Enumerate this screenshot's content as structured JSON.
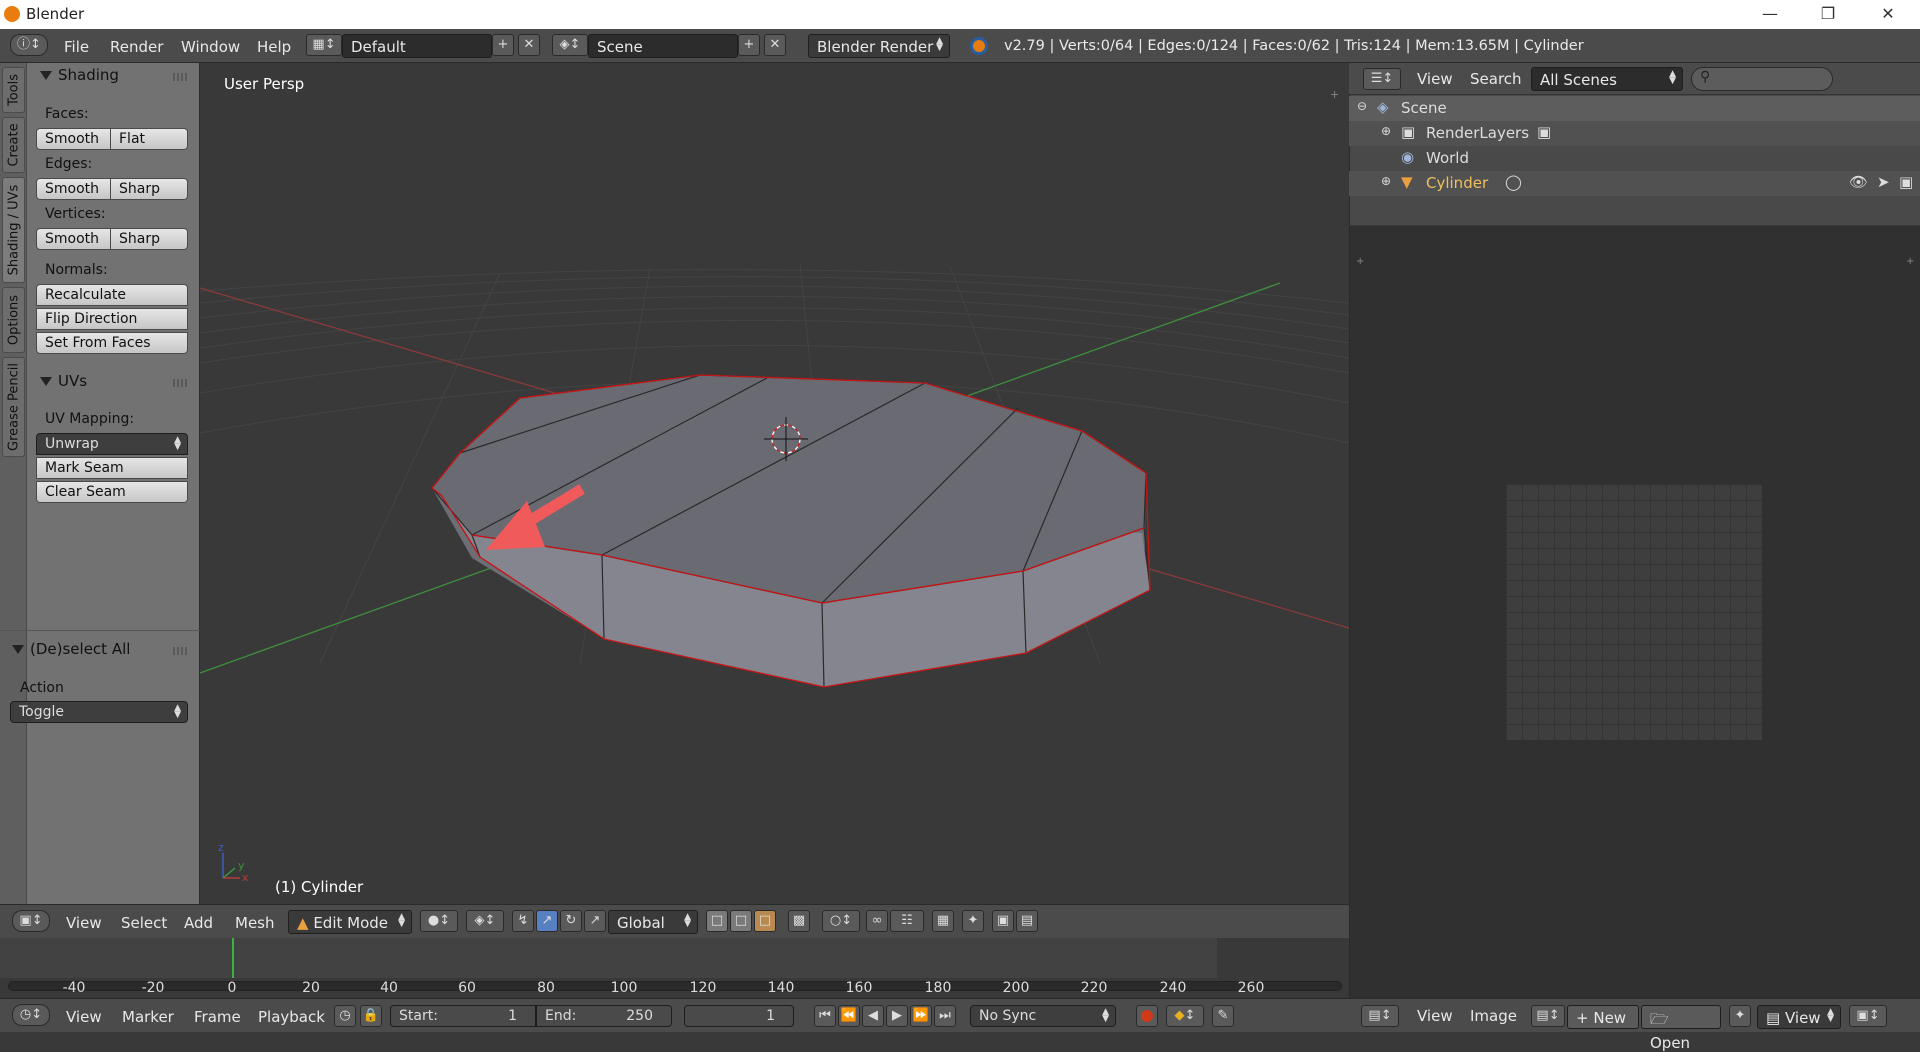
{
  "window": {
    "title": "Blender",
    "controls": [
      "minimize-icon",
      "maximize-icon",
      "close-icon"
    ]
  },
  "infobar": {
    "menus": [
      "File",
      "Render",
      "Window",
      "Help"
    ],
    "screen_layout": "Default",
    "scene": "Scene",
    "render_engine": "Blender Render",
    "stats": "v2.79 | Verts:0/64 | Edges:0/124 | Faces:0/62 | Tris:124 | Mem:13.65M | Cylinder"
  },
  "toolshelf": {
    "tabs": [
      "Tools",
      "Create",
      "Shading / UVs",
      "Options",
      "Grease Pencil"
    ],
    "active_tab": "Shading / UVs",
    "shading_panel": {
      "title": "Shading",
      "faces_label": "Faces:",
      "faces_smooth": "Smooth",
      "faces_flat": "Flat",
      "edges_label": "Edges:",
      "edges_smooth": "Smooth",
      "edges_sharp": "Sharp",
      "vertices_label": "Vertices:",
      "vertices_smooth": "Smooth",
      "vertices_sharp": "Sharp",
      "normals_label": "Normals:",
      "recalculate": "Recalculate",
      "flip_direction": "Flip Direction",
      "set_from_faces": "Set From Faces"
    },
    "uvs_panel": {
      "title": "UVs",
      "uv_mapping_label": "UV Mapping:",
      "unwrap": "Unwrap",
      "mark_seam": "Mark Seam",
      "clear_seam": "Clear Seam"
    },
    "operator_panel": {
      "title": "(De)select All",
      "action_label": "Action",
      "action_value": "Toggle"
    }
  },
  "viewport": {
    "view_label": "User Persp",
    "object_label": "(1) Cylinder",
    "axis_labels": [
      "z",
      "y",
      "x"
    ],
    "colors": {
      "background": "#393939",
      "edge_selected": "#c81414",
      "x_axis": "#a03a3a",
      "y_axis": "#3f8f3f",
      "arrow": "#f05a5a"
    }
  },
  "viewport_header": {
    "menus": [
      "View",
      "Select",
      "Add",
      "Mesh"
    ],
    "mode": "Edit Mode",
    "orientation": "Global"
  },
  "timeline": {
    "ticks": [
      "-40",
      "-20",
      "0",
      "20",
      "40",
      "60",
      "80",
      "100",
      "120",
      "140",
      "160",
      "180",
      "200",
      "220",
      "240",
      "260"
    ],
    "current_frame_marker": 0
  },
  "timeline_header": {
    "menus": [
      "View",
      "Marker",
      "Frame",
      "Playback"
    ],
    "start_label": "Start:",
    "start_value": "1",
    "end_label": "End:",
    "end_value": "250",
    "current_frame": "1",
    "sync": "No Sync"
  },
  "outliner": {
    "menus": [
      "View",
      "Search"
    ],
    "scenes_filter": "All Scenes",
    "search_placeholder": "",
    "items": [
      {
        "label": "Scene"
      },
      {
        "label": "RenderLayers"
      },
      {
        "label": "World"
      },
      {
        "label": "Cylinder"
      }
    ]
  },
  "image_editor_header": {
    "menus": [
      "View",
      "Image"
    ],
    "new_label": "New",
    "open_label": "Open",
    "view_label": "View"
  }
}
